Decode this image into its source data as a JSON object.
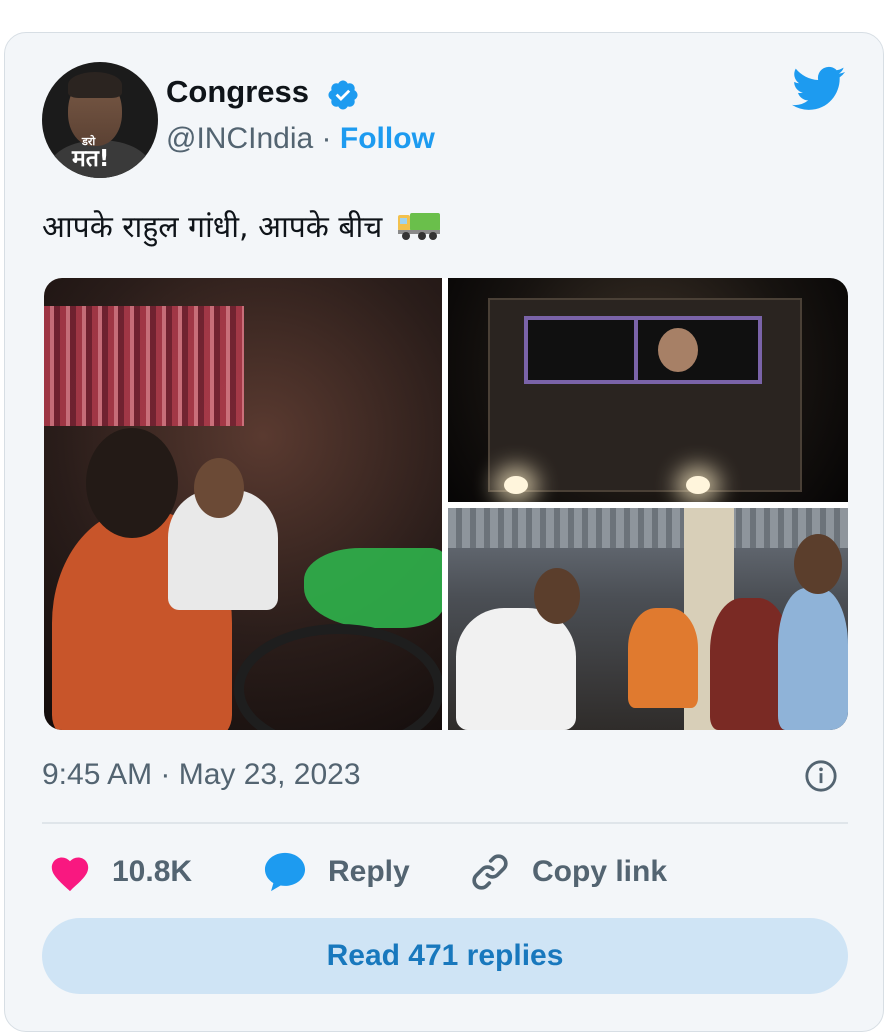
{
  "author": {
    "name": "Congress",
    "handle": "@INCIndia",
    "separator": "·",
    "follow_label": "Follow",
    "avatar_text_top": "डरो",
    "avatar_text_main": "मत!"
  },
  "tweet": {
    "text": "आपके राहुल गांधी, आपके बीच",
    "emoji": "truck",
    "timestamp": "9:45 AM · May 23, 2023"
  },
  "actions": {
    "likes": "10.8K",
    "reply_label": "Reply",
    "copy_label": "Copy link"
  },
  "read_replies_label": "Read 471 replies",
  "colors": {
    "accent": "#1d9bf0",
    "like": "#f91880",
    "muted": "#536471",
    "card_bg": "#f3f6f9",
    "button_bg": "#cfe4f5"
  },
  "icons": [
    "verified-badge-icon",
    "twitter-bird-icon",
    "truck-emoji",
    "info-icon",
    "heart-icon",
    "reply-bubble-icon",
    "link-icon"
  ]
}
